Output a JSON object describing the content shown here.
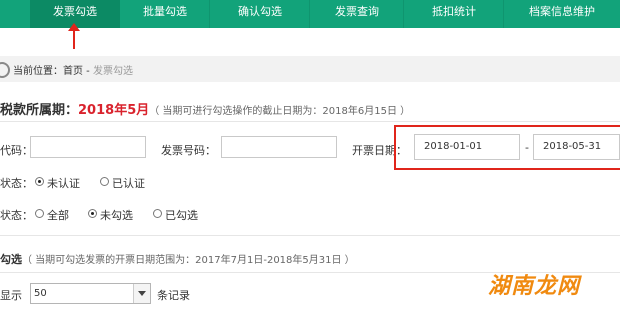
{
  "nav": {
    "tabs": [
      {
        "label": "发票勾选",
        "active": true
      },
      {
        "label": "批量勾选"
      },
      {
        "label": "确认勾选"
      },
      {
        "label": "发票查询"
      },
      {
        "label": "抵扣统计"
      },
      {
        "label": "档案信息维护"
      }
    ]
  },
  "breadcrumb": {
    "prefix": "当前位置：首页 - ",
    "current": "发票勾选"
  },
  "period": {
    "label": "税款所属期：",
    "value": "2018年5月",
    "note": "（ 当期可进行勾选操作的截止日期为：2018年6月15日 ）"
  },
  "form": {
    "code_label": "代码：",
    "number_label": "发票号码：",
    "date_label": "开票日期：",
    "date_from": "2018-01-01",
    "date_sep": "-",
    "date_to": "2018-05-31",
    "auth_label": "状态：",
    "auth_options": [
      "未认证",
      "已认证"
    ],
    "check_label": "状态：",
    "check_options": [
      "全部",
      "未勾选",
      "已勾选"
    ]
  },
  "section": {
    "title": "勾选",
    "note": "（ 当期可勾选发票的开票日期范围为：2017年7月1日-2018年5月31日 ）"
  },
  "pager": {
    "show_label": "显示",
    "page_size": "50",
    "suffix": "条记录"
  },
  "watermark": "湖南龙网",
  "colors": {
    "nav": "#12a37a",
    "nav_active": "#0c8a64",
    "highlight": "#e0251b",
    "period_value": "#d9232d"
  }
}
